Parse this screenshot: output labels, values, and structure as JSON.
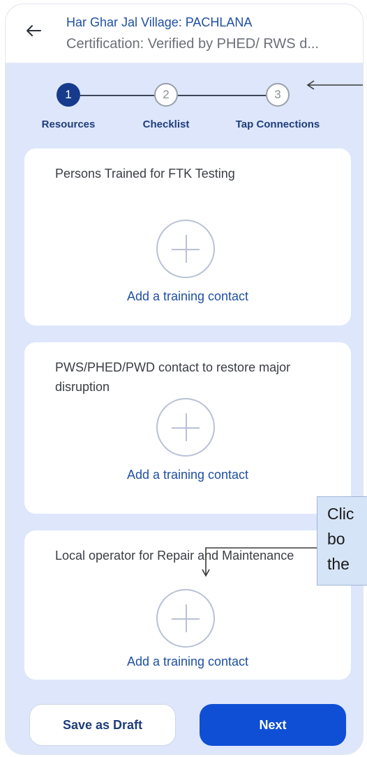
{
  "header": {
    "back_icon": "arrow-left-icon",
    "title": "Har Ghar Jal Village: PACHLANA",
    "subtitle": "Certification: Verified by PHED/ RWS d..."
  },
  "stepper": {
    "steps": [
      {
        "number": "1",
        "label": "Resources",
        "state": "active"
      },
      {
        "number": "2",
        "label": "Checklist",
        "state": "inactive"
      },
      {
        "number": "3",
        "label": "Tap Connections",
        "state": "inactive"
      }
    ]
  },
  "cards": [
    {
      "title": "Persons Trained for FTK Testing",
      "icon": "plus-circle-icon",
      "action": "Add a training contact"
    },
    {
      "title": "PWS/PHED/PWD contact to restore major disruption",
      "icon": "plus-circle-icon",
      "action": "Add a training contact"
    },
    {
      "title": "Local operator for Repair and Maintenance",
      "icon": "plus-circle-icon",
      "action": "Add a training contact"
    }
  ],
  "footer": {
    "save_draft": "Save as Draft",
    "next": "Next"
  },
  "annotation": {
    "lines": [
      "Clic",
      "bo",
      "the"
    ]
  },
  "colors": {
    "background": "#dde6fb",
    "active_step": "#163b8c",
    "link": "#1f4fa3",
    "primary_button": "#0f4fd6",
    "callout": "#d6e4f7"
  }
}
